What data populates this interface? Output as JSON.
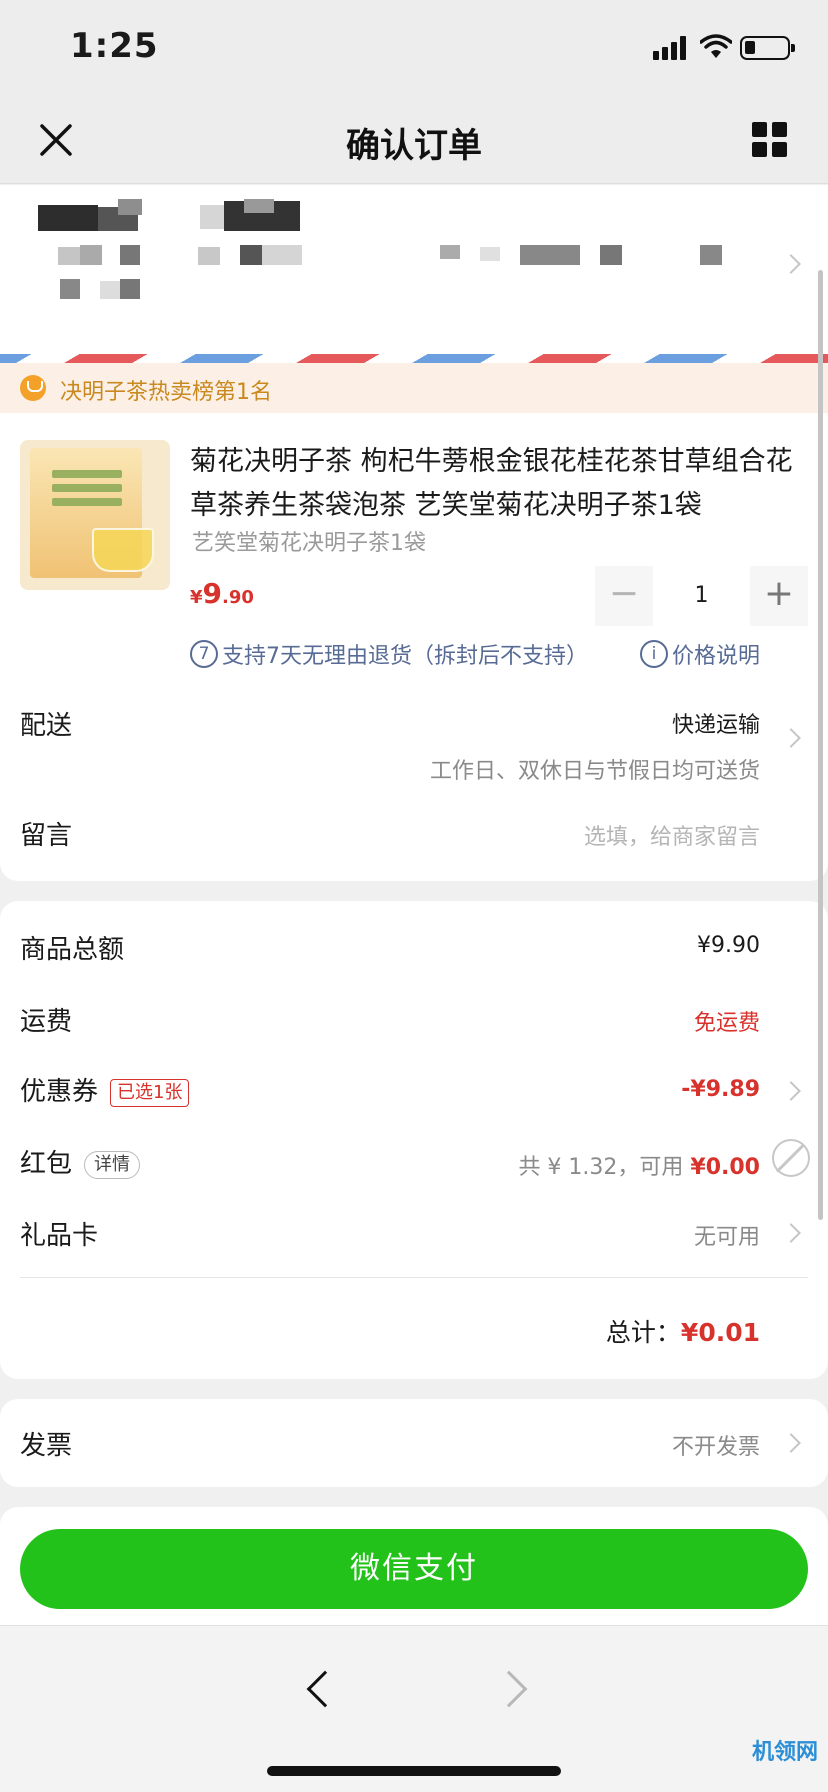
{
  "status_bar": {
    "time": "1:25"
  },
  "nav": {
    "title": "确认订单",
    "close_icon": "close-icon",
    "menu_icon": "grid-menu-icon"
  },
  "rank_banner": {
    "text": "决明子茶热卖榜第1名"
  },
  "product": {
    "title": "菊花决明子茶 枸杞牛蒡根金银花桂花茶甘草组合花草茶养生茶袋泡茶 艺笑堂菊花决明子茶1袋",
    "spec": "艺笑堂菊花决明子茶1袋",
    "price_symbol": "¥",
    "price_int": "9",
    "price_dec": ".90",
    "quantity": "1",
    "minus": "−",
    "plus": "+",
    "return_num": "7",
    "return_policy": "支持7天无理由退货（拆封后不支持）",
    "price_note_icon": "i",
    "price_note": "价格说明"
  },
  "delivery": {
    "label": "配送",
    "method": "快递运输",
    "detail": "工作日、双休日与节假日均可送货"
  },
  "message": {
    "label": "留言",
    "placeholder": "选填，给商家留言"
  },
  "summary": {
    "goods_total_label": "商品总额",
    "goods_total": "¥9.90",
    "shipping_label": "运费",
    "shipping": "免运费",
    "coupon_label": "优惠券",
    "coupon_badge": "已选1张",
    "coupon_value": "-¥9.89",
    "redpacket_label": "红包",
    "redpacket_badge": "详情",
    "redpacket_total": "共 ¥ 1.32，可用 ",
    "redpacket_available": "¥0.00",
    "giftcard_label": "礼品卡",
    "giftcard_value": "无可用",
    "total_label": "总计：",
    "total_value": "¥0.01"
  },
  "invoice": {
    "label": "发票",
    "value": "不开发票"
  },
  "pay_button": "微信支付",
  "watermark": "机领网",
  "colors": {
    "accent_red": "#d8322c",
    "pay_green": "#22c21a",
    "link_blue": "#576b95",
    "rank_gold": "#c9891e"
  }
}
